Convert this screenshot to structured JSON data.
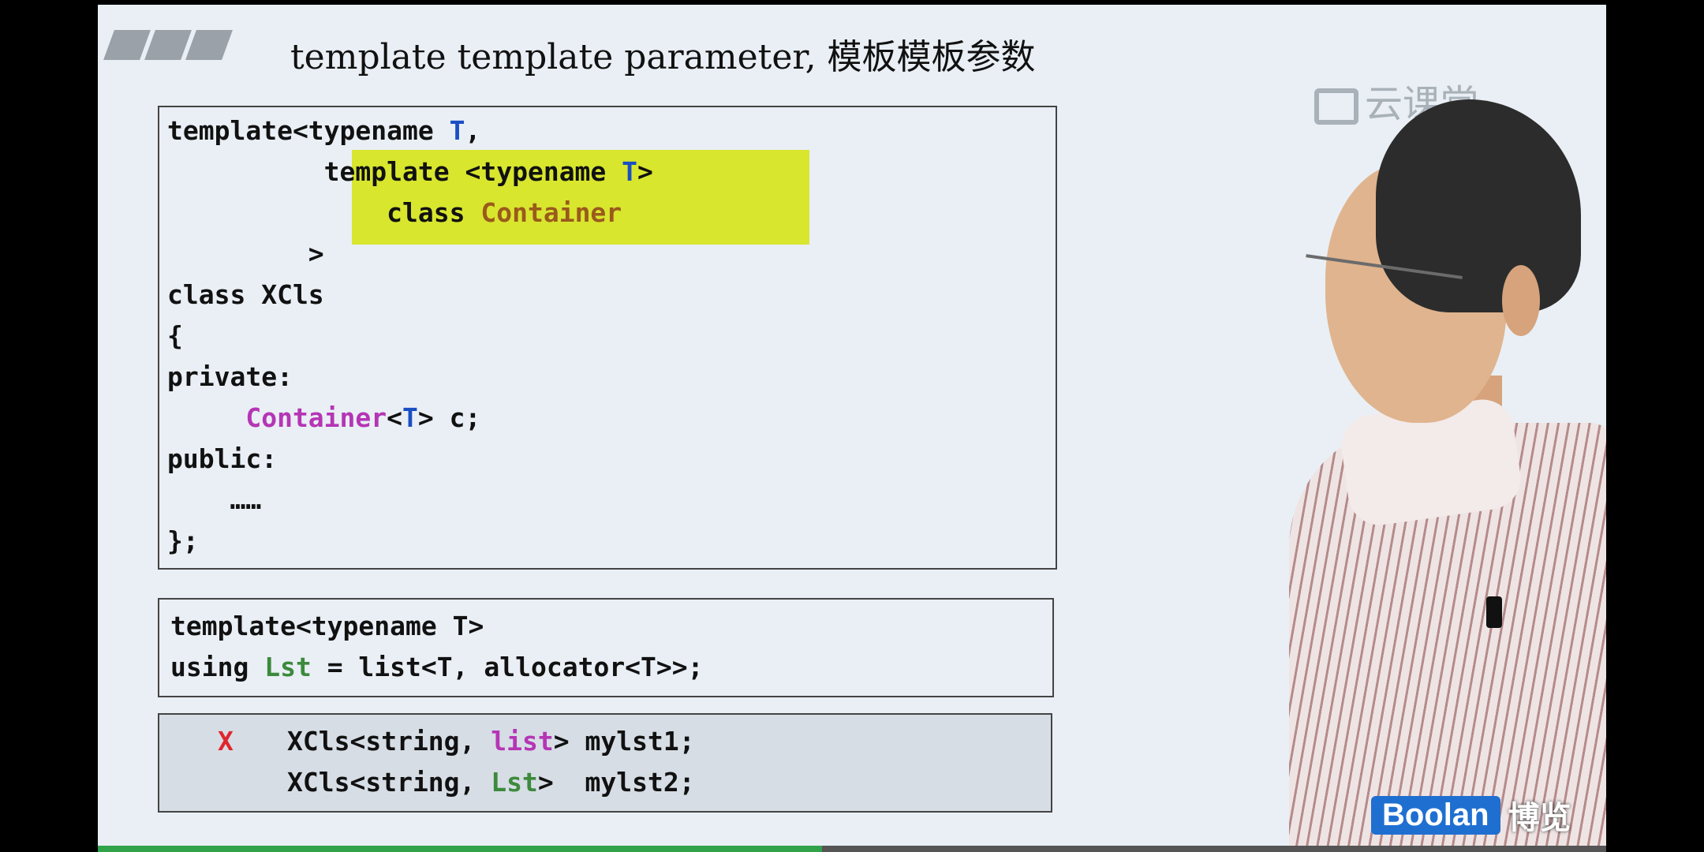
{
  "slide": {
    "title": "template template parameter, 模板模板参数",
    "watermark": "云课堂",
    "brand_en": "Boolan",
    "brand_cn": "博览"
  },
  "code_box_1": {
    "l1a": "template<typename ",
    "l1b": "T",
    "l1c": ",",
    "l2a": "          template <typename ",
    "l2b": "T",
    "l2c": ">",
    "l3a": "              class ",
    "l3b": "Container",
    "l4": "         >",
    "l5": "class XCls",
    "l6": "{",
    "l7": "private:",
    "l8a": "     Container",
    "l8b": "<",
    "l8c": "T",
    "l8d": "> c;",
    "l9": "public:",
    "l10": "    ……",
    "l11": "};"
  },
  "code_box_2": {
    "l1": "template<typename T>",
    "l2a": "using ",
    "l2b": "Lst",
    "l2c": " = list<T, allocator<T>>;"
  },
  "code_box_3": {
    "mark": "X",
    "l1a": "XCls<string, ",
    "l1b": "list",
    "l1c": "> mylst1;",
    "l2a": "XCls<string, ",
    "l2b": "Lst",
    "l2c": ">  mylst2;"
  },
  "video": {
    "progress": 0.48
  },
  "colors": {
    "slide_bg": "#e9eff5",
    "keyword_blue": "#1a4fc4",
    "container_brown": "#9a5a1c",
    "list_magenta": "#b535b5",
    "lst_green": "#3c8a3c",
    "error_red": "#e0262c",
    "highlight": "#d8e62e",
    "progress_green": "#2fa24a"
  }
}
